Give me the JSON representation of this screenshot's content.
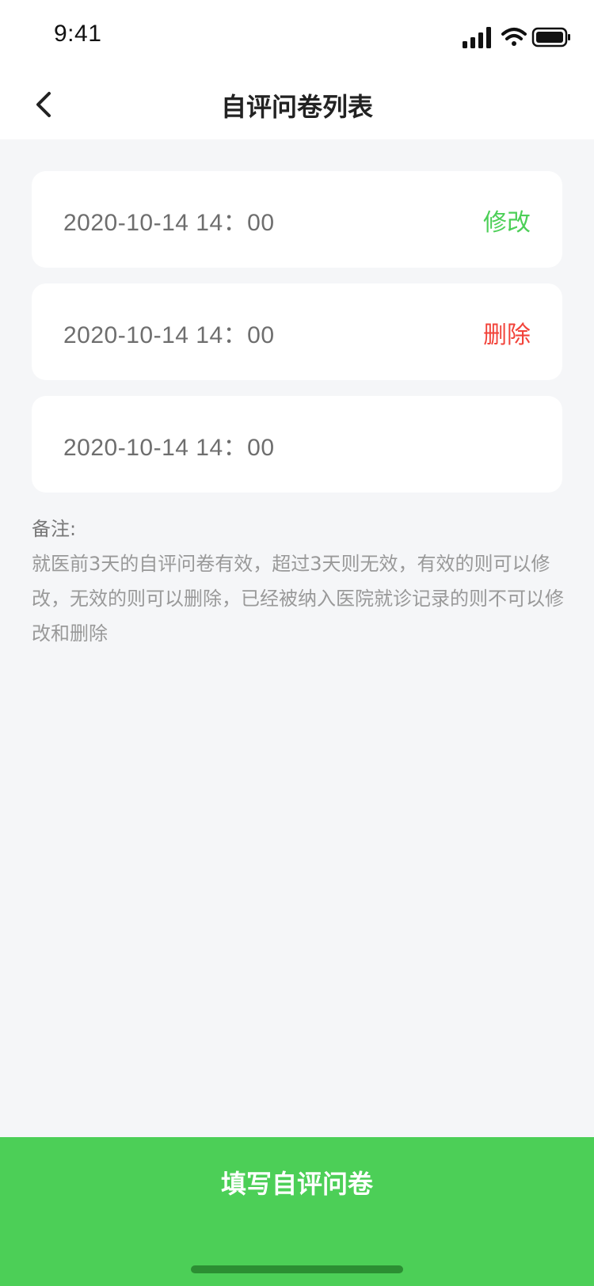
{
  "status_bar": {
    "time": "9:41"
  },
  "nav": {
    "title": "自评问卷列表",
    "back_icon": "chevron-left-icon"
  },
  "records": [
    {
      "time": "2020-10-14 14：00",
      "action": "修改",
      "action_color": "#4ccf57"
    },
    {
      "time": "2020-10-14 14：00",
      "action": "删除",
      "action_color": "#f2433a"
    },
    {
      "time": "2020-10-14 14：00",
      "action": ""
    }
  ],
  "note": {
    "title": "备注:",
    "body": "就医前3天的自评问卷有效，超过3天则无效，有效的则可以修改，无效的则可以删除，已经被纳入医院就诊记录的则不可以修改和删除"
  },
  "bottom": {
    "button_label": "填写自评问卷"
  },
  "colors": {
    "accent": "#4ccf57",
    "danger": "#f2433a"
  }
}
